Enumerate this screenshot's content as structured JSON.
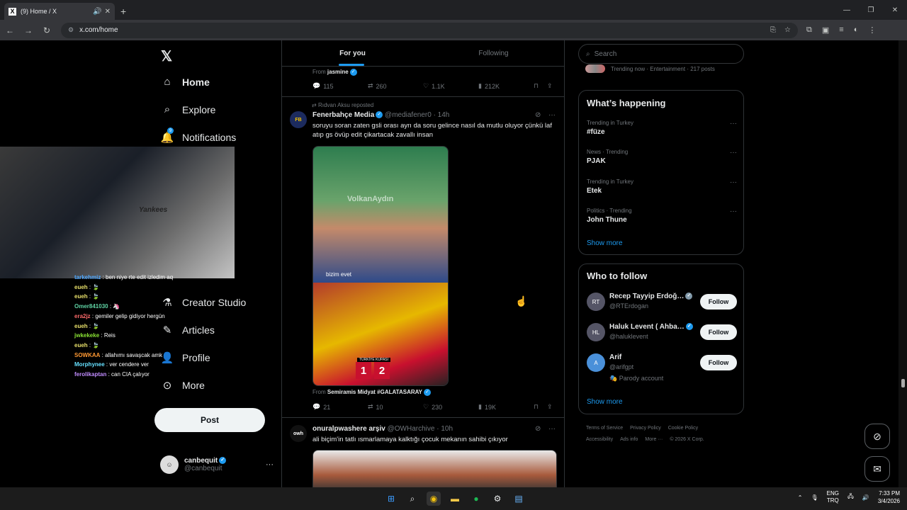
{
  "browser": {
    "tab_title": "(9) Home / X",
    "tab_favicon": "X",
    "url": "x.com/home"
  },
  "nav": {
    "items": [
      {
        "label": "Home",
        "icon": "home-icon"
      },
      {
        "label": "Explore",
        "icon": "search-icon"
      },
      {
        "label": "Notifications",
        "icon": "bell-icon",
        "badge": "9"
      },
      {
        "label": "Creator Studio",
        "icon": "flask-icon"
      },
      {
        "label": "Articles",
        "icon": "article-icon"
      },
      {
        "label": "Profile",
        "icon": "person-icon"
      },
      {
        "label": "More",
        "icon": "more-circle-icon"
      }
    ],
    "post_button": "Post",
    "account": {
      "name": "canbequit",
      "handle": "@canbequit"
    }
  },
  "stream": {
    "webcam_label": "Yankees",
    "chat": [
      {
        "user": "tarkehmiz",
        "msg": "ben niye rte edit izledim aq",
        "color": "#4fa8ff"
      },
      {
        "user": "eueh",
        "msg": "🍃",
        "color": "#e8e06a"
      },
      {
        "user": "eueh",
        "msg": "🍃",
        "color": "#e8e06a"
      },
      {
        "user": "Omer841030",
        "msg": "🦄",
        "color": "#5fd3a4"
      },
      {
        "user": "era2jz",
        "msg": "gemiler gelip gidiyor hergün",
        "color": "#ff6b6b"
      },
      {
        "user": "eueh",
        "msg": "🍃",
        "color": "#e8e06a"
      },
      {
        "user": "jwkekeke",
        "msg": "Reis",
        "color": "#8ae234"
      },
      {
        "user": "eueh",
        "msg": "🍃",
        "color": "#e8e06a"
      },
      {
        "user": "SOWKAA",
        "msg": "allahımı savaşcak amk",
        "color": "#ff9933"
      },
      {
        "user": "Morphynee",
        "msg": "ver cendere ver",
        "color": "#66e0ff"
      },
      {
        "user": "ferolikaptan",
        "msg": "can CIA çalıyor",
        "color": "#c18cff"
      }
    ]
  },
  "feed": {
    "tabs": [
      "For you",
      "Following"
    ],
    "post0": {
      "from_label": "From",
      "from_name": "jasmine",
      "replies": "115",
      "reposts": "260",
      "likes": "1.1K",
      "views": "212K"
    },
    "post1": {
      "reposted_by": "Rıdvan Aksu reposted",
      "name": "Fenerbahçe Media",
      "handle": "@mediafener0",
      "time": "· 14h",
      "avatar": "FB",
      "text": "soruyu soran zaten gsli orası ayrı da soru gelince nasıl da mutlu oluyor çünkü laf atıp gs övüp edit çikartacak zavallı insan",
      "media_watermark": "VolkanAydın",
      "media_caption": "bizim evet",
      "cup_label": "TÜRKİYE KUPASI",
      "score_home": "1",
      "score_away": "2",
      "from_label": "From",
      "from_name": "Semiramis Midyat #GALATASARAY",
      "replies": "21",
      "reposts": "10",
      "likes": "230",
      "views": "19K"
    },
    "post2": {
      "name": "onuralpwashere arşiv",
      "handle": "@OWHarchive",
      "time": "· 10h",
      "avatar": "owh",
      "text": "ali biçim'in tatlı ısmarlamaya kalktığı çocuk mekanın sahibi çıkıyor"
    }
  },
  "sidebar": {
    "search_placeholder": "Search",
    "trending_now": "Trending now · Entertainment · 217 posts",
    "happening_title": "What’s happening",
    "trends": [
      {
        "category": "Trending in Turkey",
        "name": "#füze"
      },
      {
        "category": "News · Trending",
        "name": "PJAK"
      },
      {
        "category": "Trending in Turkey",
        "name": "Etek"
      },
      {
        "category": "Politics · Trending",
        "name": "John Thune"
      }
    ],
    "show_more": "Show more",
    "wtf_title": "Who to follow",
    "who_to_follow": [
      {
        "name": "Recep Tayyip Erdoğ…",
        "handle": "@RTErdogan",
        "verified": "gray",
        "avatar": "RT"
      },
      {
        "name": "Haluk Levent ( Ahba…",
        "handle": "@haluklevent",
        "verified": "blue",
        "avatar": "HL"
      },
      {
        "name": "Arif",
        "handle": "@arifgpt",
        "verified": "",
        "avatar": "A",
        "note": "🎭 Parody account"
      }
    ],
    "follow_label": "Follow",
    "footer": [
      "Terms of Service",
      "Privacy Policy",
      "Cookie Policy",
      "Accessibility",
      "Ads info",
      "More ···",
      "© 2026 X Corp."
    ]
  },
  "taskbar": {
    "lang": "ENG",
    "lang2": "TRQ",
    "time": "7:33 PM",
    "date": "3/4/2026"
  }
}
